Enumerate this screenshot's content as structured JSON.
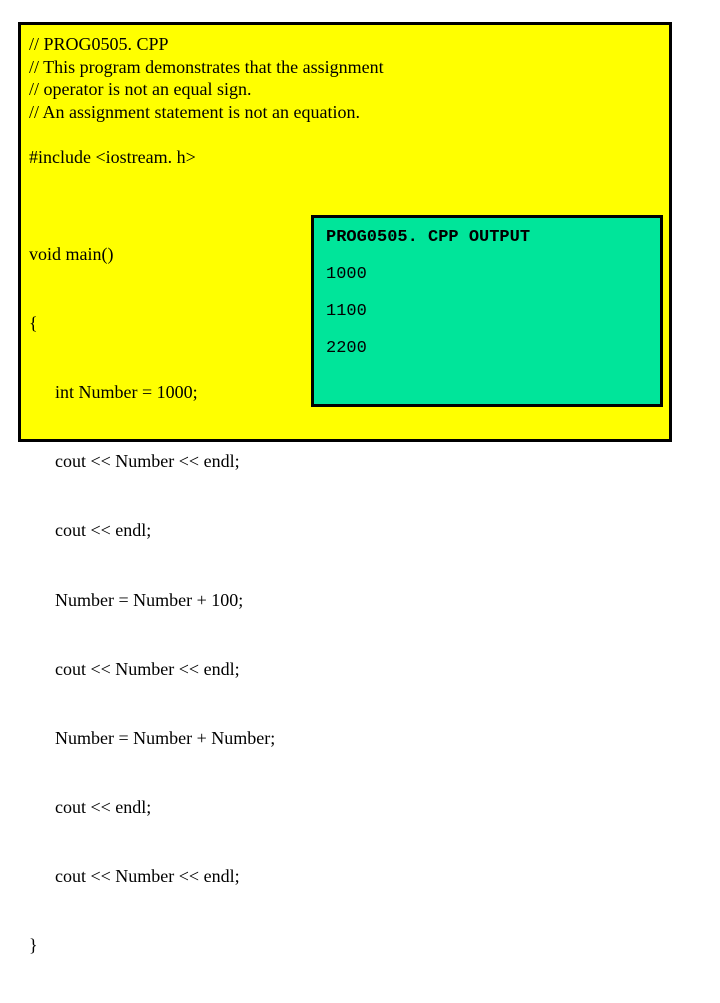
{
  "comments": {
    "l1": "// PROG0505. CPP",
    "l2": "// This program demonstrates that the assignment",
    "l3": "// operator is not an equal sign.",
    "l4": "// An assignment statement is not an equation."
  },
  "include": "#include <iostream. h>",
  "code": {
    "l1": "void main()",
    "l2": "{",
    "l3": "int Number = 1000;",
    "l4": "cout << Number << endl;",
    "l5": "cout << endl;",
    "l6": "Number = Number + 100;",
    "l7": "cout << Number << endl;",
    "l8": "Number = Number + Number;",
    "l9": "cout << endl;",
    "l10": "cout << Number << endl;",
    "l11": "}"
  },
  "output": {
    "title": "PROG0505. CPP  OUTPUT",
    "v1": "1000",
    "v2": "1100",
    "v3": "2200"
  }
}
